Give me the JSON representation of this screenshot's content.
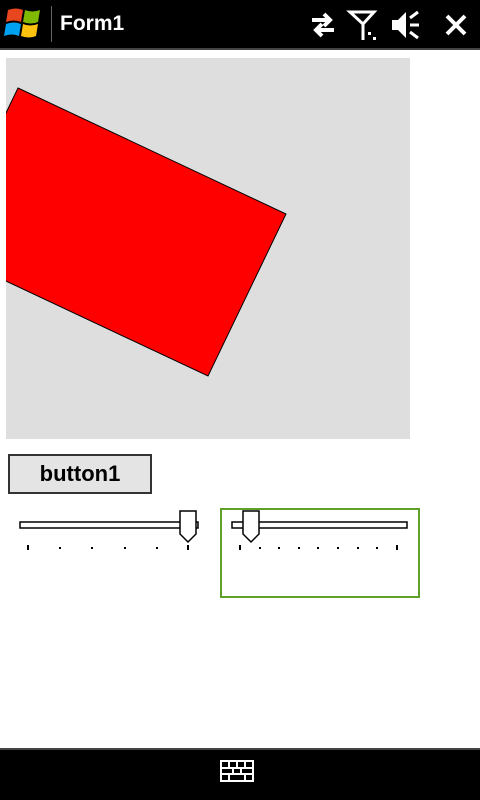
{
  "window": {
    "title": "Form1"
  },
  "titlebar_icons": [
    "connectivity-icon",
    "signal-icon",
    "volume-muted-icon",
    "close-icon"
  ],
  "canvas": {
    "background": "#dedede",
    "shape_fill": "#ff0000",
    "shape_stroke": "#000000"
  },
  "controls": {
    "button1_label": "button1"
  },
  "trackbars": [
    {
      "name": "trackbar1",
      "min": 0,
      "max": 5,
      "value": 5,
      "ticks": 6,
      "focused": false
    },
    {
      "name": "trackbar2",
      "min": 0,
      "max": 9,
      "value": 1,
      "ticks": 10,
      "focused": true
    }
  ],
  "colors": {
    "focus_border": "#5ea02a",
    "bar_background": "#000000"
  },
  "bottombar": {
    "icon": "keyboard-icon"
  }
}
